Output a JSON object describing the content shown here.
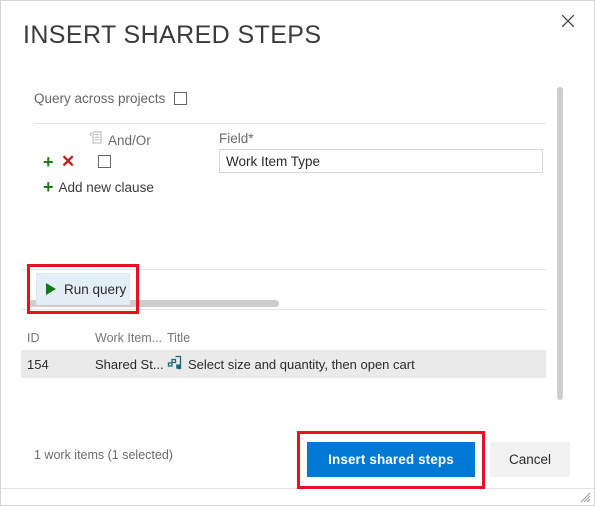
{
  "dialog": {
    "title": "INSERT SHARED STEPS",
    "close_icon": "close-icon"
  },
  "query": {
    "across_projects_label": "Query across projects",
    "across_projects_checked": false,
    "group_icon": "group-clauses-icon",
    "headers": {
      "and_or": "And/Or",
      "field": "Field*"
    },
    "clause": {
      "add_icon": "plus-icon",
      "delete_icon": "delete-x-icon",
      "row_checked": false,
      "field_value": "Work Item Type",
      "field_placeholder": "Work Item Type"
    },
    "add_new_clause_label": "Add new clause",
    "add_new_clause_icon": "plus-icon"
  },
  "run_query": {
    "label": "Run query",
    "icon": "play-icon",
    "highlighted": true,
    "highlight_color": "#e81123",
    "button_bg": "#e3eef7",
    "play_color": "#107c10"
  },
  "results": {
    "columns": [
      "ID",
      "Work Item...",
      "Title"
    ],
    "rows": [
      {
        "id": "154",
        "work_item_type": "Shared St...",
        "title": "Select size and quantity, then open cart",
        "icon": "shared-steps-icon",
        "selected": true
      }
    ]
  },
  "footer": {
    "count_text": "1 work items (1 selected)",
    "primary_button": "Insert shared steps",
    "secondary_button": "Cancel",
    "primary_color": "#0078d4",
    "highlight_color": "#e81123"
  },
  "scrollbars": {
    "vertical_thumb_color": "#cdcdcd",
    "horizontal_thumb_color": "#cdcdcd"
  }
}
